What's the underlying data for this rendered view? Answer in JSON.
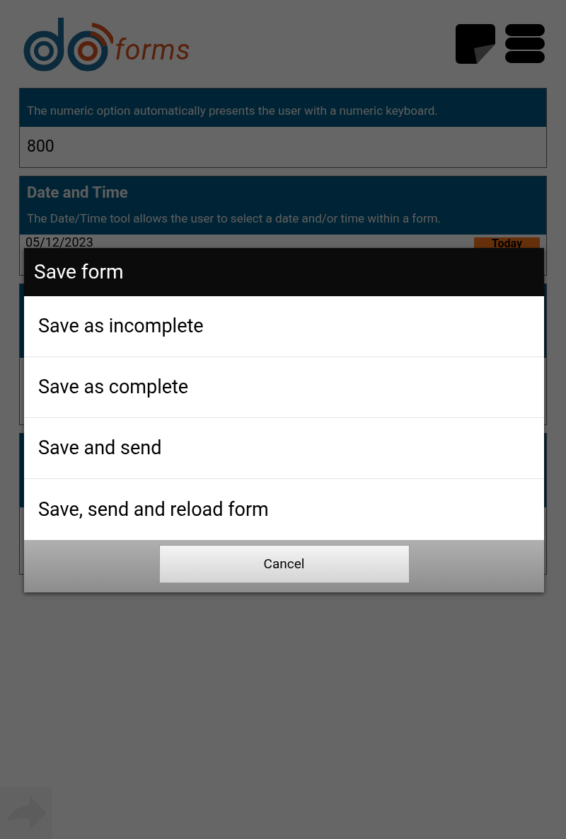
{
  "header": {
    "logo_text": "forms"
  },
  "fields": [
    {
      "kind": "number",
      "description": "The numeric option automatically presents the user with a numeric keyboard.",
      "value": "800"
    },
    {
      "kind": "date",
      "label": "Date and Time",
      "description": "The Date/Time tool allows the user to select a date and/or time within a form.",
      "value": "05/12/2023",
      "button": "Today"
    },
    {
      "kind": "covered"
    },
    {
      "kind": "covered"
    }
  ],
  "dialog": {
    "title": "Save form",
    "options": [
      "Save as incomplete",
      "Save as complete",
      "Save and send",
      "Save, send and reload form"
    ],
    "cancel": "Cancel"
  }
}
